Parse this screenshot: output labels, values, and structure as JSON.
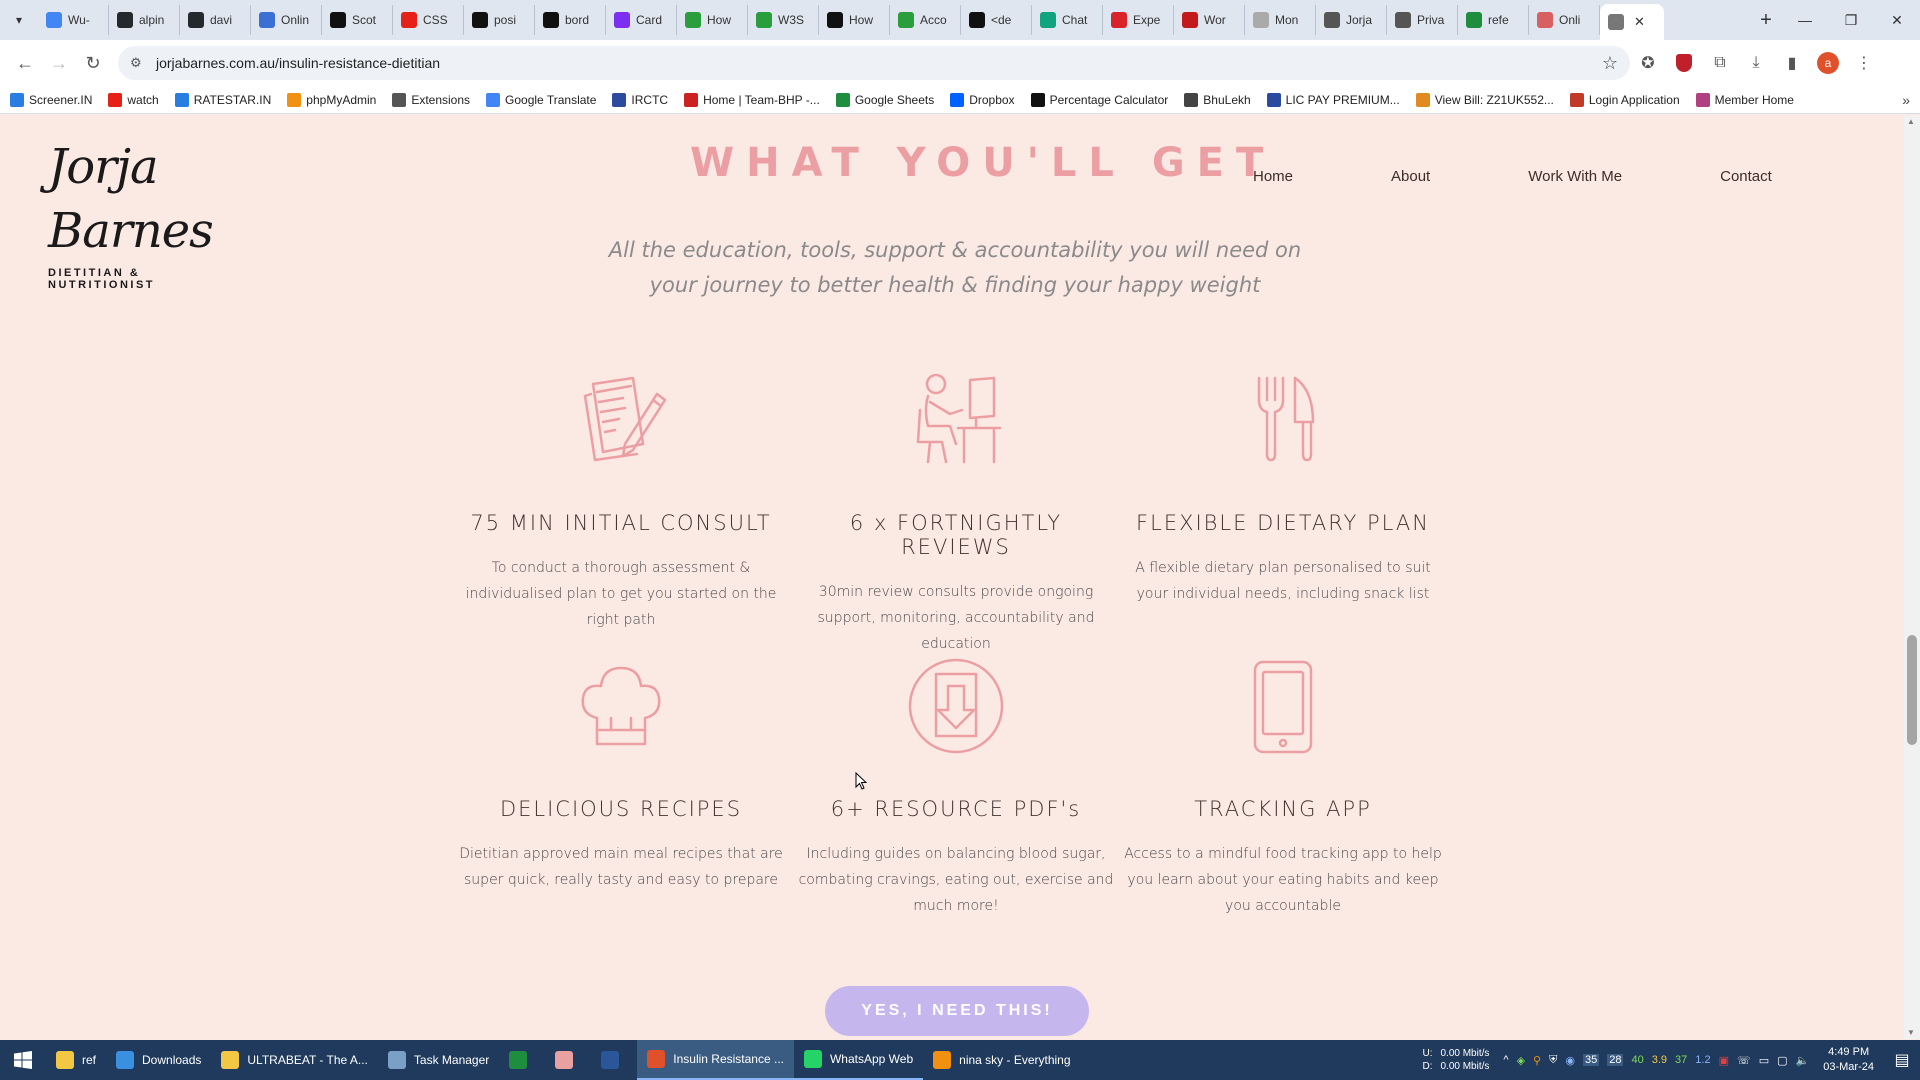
{
  "browser": {
    "tabs": [
      {
        "title": "Wu-",
        "icon": "google-icon",
        "color": "#4285f4"
      },
      {
        "title": "alpin",
        "icon": "github-icon",
        "color": "#24292e"
      },
      {
        "title": "davi",
        "icon": "github-icon",
        "color": "#24292e"
      },
      {
        "title": "Onlin",
        "icon": "globe-icon",
        "color": "#3b6fd4"
      },
      {
        "title": "Scot",
        "icon": "s-icon",
        "color": "#111111"
      },
      {
        "title": "CSS",
        "icon": "youtube-icon",
        "color": "#e62117"
      },
      {
        "title": "posi",
        "icon": "medium-icon",
        "color": "#111111"
      },
      {
        "title": "bord",
        "icon": "medium-icon",
        "color": "#111111"
      },
      {
        "title": "Card",
        "icon": "bootstrap-icon",
        "color": "#7b2ff0"
      },
      {
        "title": "How",
        "icon": "w-icon",
        "color": "#2a9d3c"
      },
      {
        "title": "W3S",
        "icon": "w-icon",
        "color": "#2a9d3c"
      },
      {
        "title": "How",
        "icon": "a-icon",
        "color": "#111111"
      },
      {
        "title": "Acco",
        "icon": "link-icon",
        "color": "#2a9d3c"
      },
      {
        "title": "<de",
        "icon": "medium-icon",
        "color": "#111111"
      },
      {
        "title": "Chat",
        "icon": "chatgpt-icon",
        "color": "#10a37f"
      },
      {
        "title": "Expe",
        "icon": "pdf-icon",
        "color": "#d8232a"
      },
      {
        "title": "Wor",
        "icon": "pdf-icon",
        "color": "#c21a1a"
      },
      {
        "title": "Mon",
        "icon": "cloud-icon",
        "color": "#aaaaaa"
      },
      {
        "title": "Jorja",
        "icon": "jb-icon",
        "color": "#555555"
      },
      {
        "title": "Priva",
        "icon": "w-icon",
        "color": "#555555"
      },
      {
        "title": "refe",
        "icon": "sheets-icon",
        "color": "#1e8e3e"
      },
      {
        "title": "Onli",
        "icon": "a-icon",
        "color": "#d86060"
      }
    ],
    "active_tab_icon": "jb-icon",
    "url": "jorjabarnes.com.au/insulin-resistance-dietitian",
    "profile_initial": "a",
    "bookmarks": [
      {
        "label": "Screener.IN",
        "color": "#2a7de1"
      },
      {
        "label": "watch",
        "color": "#e62117"
      },
      {
        "label": "RATESTAR.IN",
        "color": "#2a7de1"
      },
      {
        "label": "phpMyAdmin",
        "color": "#f29111"
      },
      {
        "label": "Extensions",
        "color": "#555555"
      },
      {
        "label": "Google Translate",
        "color": "#4285f4"
      },
      {
        "label": "IRCTC",
        "color": "#2b4aa0"
      },
      {
        "label": "Home | Team-BHP -...",
        "color": "#cc2222"
      },
      {
        "label": "Google Sheets",
        "color": "#1e8e3e"
      },
      {
        "label": "Dropbox",
        "color": "#0061ff"
      },
      {
        "label": "Percentage Calculator",
        "color": "#111111"
      },
      {
        "label": "BhuLekh",
        "color": "#444444"
      },
      {
        "label": "LIC PAY PREMIUM...",
        "color": "#2b4aa0"
      },
      {
        "label": "View Bill: Z21UK552...",
        "color": "#e08a20"
      },
      {
        "label": "Login Application",
        "color": "#c03a2a"
      },
      {
        "label": "Member Home",
        "color": "#b04080"
      }
    ]
  },
  "site": {
    "logo_script": "Jorja Barnes",
    "logo_tagline": "DIETITIAN & NUTRITIONIST",
    "nav": [
      "Home",
      "About",
      "Work With Me",
      "Contact"
    ],
    "heading": "WHAT YOU'LL GET",
    "subheading": "All the education, tools, support & accountability you will need on your journey to better health & finding your happy weight",
    "features": [
      {
        "icon": "clipboard-pen-icon",
        "title": "75 MIN INITIAL CONSULT",
        "desc": "To conduct a thorough assessment & individualised plan to get you started on the right path"
      },
      {
        "icon": "desk-worker-icon",
        "title": "6 x FORTNIGHTLY REVIEWS",
        "desc": "30min review consults provide ongoing support, monitoring, accountability and education"
      },
      {
        "icon": "fork-knife-icon",
        "title": "FLEXIBLE DIETARY PLAN",
        "desc": "A flexible dietary plan personalised to suit your individual needs, including snack list"
      },
      {
        "icon": "chef-hat-icon",
        "title": "DELICIOUS RECIPES",
        "desc": "Dietitian approved main meal recipes that are super quick, really tasty and easy to prepare"
      },
      {
        "icon": "download-tablet-icon",
        "title": "6+ RESOURCE PDF's",
        "desc": "Including guides on balancing blood sugar, combating cravings, eating out, exercise and much more!"
      },
      {
        "icon": "smartphone-icon",
        "title": "TRACKING APP",
        "desc": "Access to a mindful food tracking app to help you learn about your eating habits and keep you accountable"
      }
    ],
    "cta": "YES, I NEED THIS!",
    "accent_color": "#ec9fa3",
    "cta_color": "#c6b6ee",
    "bg_color": "#fbe9e4"
  },
  "taskbar": {
    "items": [
      {
        "label": "ref",
        "color": "#f2c744",
        "state": ""
      },
      {
        "label": "Downloads",
        "color": "#3b8fe0",
        "state": ""
      },
      {
        "label": "ULTRABEAT - The A...",
        "color": "#f2c744",
        "state": ""
      },
      {
        "label": "Task Manager",
        "color": "#7aa0c8",
        "state": ""
      },
      {
        "label": "",
        "color": "#1e8e3e",
        "state": ""
      },
      {
        "label": "",
        "color": "#e8a0a0",
        "state": ""
      },
      {
        "label": "",
        "color": "#2b579a",
        "state": ""
      },
      {
        "label": "Insulin Resistance ...",
        "color": "#e0502a",
        "state": "active"
      },
      {
        "label": "WhatsApp Web",
        "color": "#25d366",
        "state": "open"
      },
      {
        "label": "nina sky - Everything",
        "color": "#f29111",
        "state": ""
      }
    ],
    "net_labels": [
      "U:",
      "D:"
    ],
    "net_up": "0.00 Mbit/s",
    "net_down": "0.00 Mbit/s",
    "tray_numbers": [
      "35",
      "28",
      "40",
      "3.9",
      "37",
      "1.2"
    ],
    "time": "4:49 PM",
    "date": "03-Mar-24"
  }
}
